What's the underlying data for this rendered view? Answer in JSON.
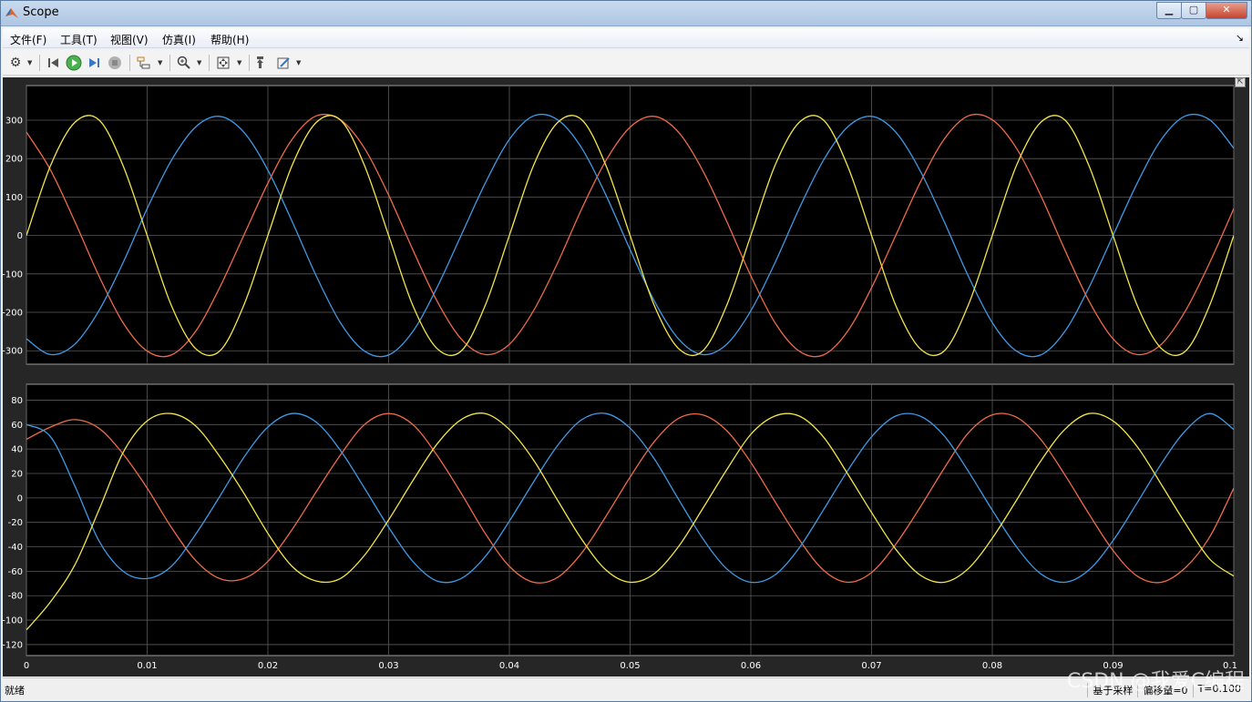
{
  "window": {
    "title": "Scope",
    "min_label": "▁",
    "max_label": "▢",
    "close_label": "✕"
  },
  "menu": {
    "items": [
      "文件(F)",
      "工具(T)",
      "视图(V)",
      "仿真(I)",
      "帮助(H)"
    ],
    "dock_glyph": "↘"
  },
  "toolbar": {
    "icons": [
      "gear-icon",
      "step-back-icon",
      "run-icon",
      "step-forward-icon",
      "stop-icon",
      "signal-select-icon",
      "zoom-icon",
      "autoscale-icon",
      "measure-icon",
      "style-icon"
    ]
  },
  "colors": {
    "series1": "#ee6b4a",
    "series2": "#3f9ae6",
    "series3": "#f4e64a",
    "bg": "#000000",
    "grid": "#5a5a5a",
    "axis_text": "#ffffff"
  },
  "chart_data": [
    {
      "type": "line",
      "xlim": [
        0,
        0.1
      ],
      "ylim": [
        -335,
        390
      ],
      "yticks": [
        -300,
        -200,
        -100,
        0,
        100,
        200,
        300
      ],
      "ytick_labels": [
        "-300",
        "-200",
        "-100",
        "0",
        "100",
        "200",
        "300"
      ],
      "xticks": [
        0,
        0.01,
        0.02,
        0.03,
        0.04,
        0.05,
        0.06,
        0.07,
        0.08,
        0.09,
        0.1
      ],
      "xtick_labels": [],
      "grid": true,
      "series": [
        {
          "color_key": "series1",
          "x": [
            0,
            0.002,
            0.004,
            0.006,
            0.008,
            0.01,
            0.012,
            0.014,
            0.016,
            0.018,
            0.02,
            0.022,
            0.024,
            0.026,
            0.028,
            0.03,
            0.032,
            0.034,
            0.036,
            0.038,
            0.04,
            0.042,
            0.044,
            0.046,
            0.048,
            0.05,
            0.052,
            0.054,
            0.056,
            0.058,
            0.06,
            0.062,
            0.064,
            0.066,
            0.068,
            0.07,
            0.072,
            0.074,
            0.076,
            0.078,
            0.08,
            0.082,
            0.084,
            0.086,
            0.088,
            0.09,
            0.092,
            0.094,
            0.096,
            0.098,
            0.1
          ],
          "y": [
            269,
            170,
            37,
            -105,
            -227,
            -301,
            -311,
            -250,
            -136,
            0,
            136,
            250,
            311,
            301,
            227,
            105,
            -37,
            -170,
            -269,
            -310,
            -283,
            -196,
            -71,
            70,
            195,
            282,
            310,
            269,
            170,
            37,
            -105,
            -227,
            -301,
            -311,
            -250,
            -136,
            0,
            136,
            250,
            311,
            301,
            227,
            105,
            -37,
            -170,
            -269,
            -310,
            -283,
            -196,
            -71,
            70
          ]
        },
        {
          "color_key": "series2",
          "x": [
            0,
            0.002,
            0.004,
            0.006,
            0.008,
            0.01,
            0.012,
            0.014,
            0.016,
            0.018,
            0.02,
            0.022,
            0.024,
            0.026,
            0.028,
            0.03,
            0.032,
            0.034,
            0.036,
            0.038,
            0.04,
            0.042,
            0.044,
            0.046,
            0.048,
            0.05,
            0.052,
            0.054,
            0.056,
            0.058,
            0.06,
            0.062,
            0.064,
            0.066,
            0.068,
            0.07,
            0.072,
            0.074,
            0.076,
            0.078,
            0.08,
            0.082,
            0.084,
            0.086,
            0.088,
            0.09,
            0.092,
            0.094,
            0.096,
            0.098,
            0.1
          ],
          "y": [
            -269,
            -310,
            -283,
            -196,
            -71,
            70,
            195,
            282,
            310,
            269,
            170,
            37,
            -105,
            -227,
            -301,
            -311,
            -250,
            -136,
            0,
            136,
            250,
            311,
            301,
            227,
            105,
            -37,
            -170,
            -269,
            -310,
            -283,
            -196,
            -71,
            70,
            195,
            282,
            310,
            269,
            170,
            37,
            -105,
            -227,
            -301,
            -311,
            -250,
            -136,
            0,
            136,
            250,
            311,
            301,
            227
          ]
        },
        {
          "color_key": "series3",
          "x": [
            0,
            0.002,
            0.004,
            0.006,
            0.008,
            0.01,
            0.012,
            0.014,
            0.016,
            0.018,
            0.02,
            0.022,
            0.024,
            0.026,
            0.028,
            0.03,
            0.032,
            0.034,
            0.036,
            0.038,
            0.04,
            0.042,
            0.044,
            0.046,
            0.048,
            0.05,
            0.052,
            0.054,
            0.056,
            0.058,
            0.06,
            0.062,
            0.064,
            0.066,
            0.068,
            0.07,
            0.072,
            0.074,
            0.076,
            0.078,
            0.08,
            0.082,
            0.084,
            0.086,
            0.088,
            0.09,
            0.092,
            0.094,
            0.096,
            0.098,
            0.1
          ],
          "y": [
            0,
            182,
            294,
            301,
            182,
            0,
            -182,
            -294,
            -301,
            -182,
            0,
            182,
            294,
            301,
            182,
            0,
            -182,
            -294,
            -301,
            -182,
            0,
            182,
            294,
            301,
            182,
            0,
            -182,
            -294,
            -301,
            -182,
            0,
            182,
            294,
            301,
            182,
            0,
            -182,
            -294,
            -301,
            -182,
            0,
            182,
            294,
            301,
            182,
            0,
            -182,
            -294,
            -301,
            -182,
            0
          ]
        }
      ]
    },
    {
      "type": "line",
      "xlim": [
        0,
        0.1
      ],
      "ylim": [
        -129,
        93
      ],
      "yticks": [
        -120,
        -100,
        -80,
        -60,
        -40,
        -20,
        0,
        20,
        40,
        60,
        80
      ],
      "ytick_labels": [
        "-120",
        "-100",
        "-80",
        "-60",
        "-40",
        "-20",
        "0",
        "20",
        "40",
        "60",
        "80"
      ],
      "xticks": [
        0,
        0.01,
        0.02,
        0.03,
        0.04,
        0.05,
        0.06,
        0.07,
        0.08,
        0.09,
        0.1
      ],
      "xtick_labels": [
        "0",
        "0.01",
        "0.02",
        "0.03",
        "0.04",
        "0.05",
        "0.06",
        "0.07",
        "0.08",
        "0.09",
        "0.1"
      ],
      "grid": true,
      "series": [
        {
          "color_key": "series1",
          "x": [
            0,
            0.002,
            0.004,
            0.006,
            0.008,
            0.01,
            0.012,
            0.014,
            0.016,
            0.018,
            0.02,
            0.022,
            0.024,
            0.026,
            0.028,
            0.03,
            0.032,
            0.034,
            0.036,
            0.038,
            0.04,
            0.042,
            0.044,
            0.046,
            0.048,
            0.05,
            0.052,
            0.054,
            0.056,
            0.058,
            0.06,
            0.062,
            0.064,
            0.066,
            0.068,
            0.07,
            0.072,
            0.074,
            0.076,
            0.078,
            0.08,
            0.082,
            0.084,
            0.086,
            0.088,
            0.09,
            0.092,
            0.094,
            0.096,
            0.098,
            0.1
          ],
          "y": [
            48,
            58,
            64,
            57,
            36,
            8,
            -24,
            -51,
            -66,
            -66,
            -52,
            -26,
            5,
            35,
            60,
            69,
            60,
            35,
            4,
            -29,
            -56,
            -69,
            -65,
            -45,
            -15,
            17,
            46,
            65,
            68,
            55,
            29,
            -3,
            -34,
            -59,
            -69,
            -61,
            -38,
            -8,
            24,
            53,
            68,
            66,
            48,
            19,
            -13,
            -43,
            -64,
            -69,
            -57,
            -32,
            8
          ]
        },
        {
          "color_key": "series2",
          "x": [
            0,
            0.002,
            0.004,
            0.006,
            0.008,
            0.01,
            0.012,
            0.014,
            0.016,
            0.018,
            0.02,
            0.022,
            0.024,
            0.026,
            0.028,
            0.03,
            0.032,
            0.034,
            0.036,
            0.038,
            0.04,
            0.042,
            0.044,
            0.046,
            0.048,
            0.05,
            0.052,
            0.054,
            0.056,
            0.058,
            0.06,
            0.062,
            0.064,
            0.066,
            0.068,
            0.07,
            0.072,
            0.074,
            0.076,
            0.078,
            0.08,
            0.082,
            0.084,
            0.086,
            0.088,
            0.09,
            0.092,
            0.094,
            0.096,
            0.098,
            0.1
          ],
          "y": [
            60,
            50,
            10,
            -35,
            -60,
            -66,
            -56,
            -30,
            1,
            33,
            58,
            69,
            62,
            39,
            8,
            -24,
            -52,
            -68,
            -66,
            -48,
            -19,
            13,
            43,
            64,
            69,
            57,
            32,
            -1,
            -33,
            -58,
            -69,
            -63,
            -41,
            -10,
            22,
            50,
            67,
            67,
            51,
            22,
            -10,
            -40,
            -62,
            -69,
            -59,
            -35,
            -4,
            28,
            55,
            69,
            56
          ]
        },
        {
          "color_key": "series3",
          "x": [
            0,
            0.002,
            0.004,
            0.006,
            0.008,
            0.01,
            0.012,
            0.014,
            0.016,
            0.018,
            0.02,
            0.022,
            0.024,
            0.026,
            0.028,
            0.03,
            0.032,
            0.034,
            0.036,
            0.038,
            0.04,
            0.042,
            0.044,
            0.046,
            0.048,
            0.05,
            0.052,
            0.054,
            0.056,
            0.058,
            0.06,
            0.062,
            0.064,
            0.066,
            0.068,
            0.07,
            0.072,
            0.074,
            0.076,
            0.078,
            0.08,
            0.082,
            0.084,
            0.086,
            0.088,
            0.09,
            0.092,
            0.094,
            0.096,
            0.098,
            0.1
          ],
          "y": [
            -108,
            -85,
            -55,
            -10,
            37,
            63,
            69,
            59,
            34,
            4,
            -29,
            -56,
            -68,
            -66,
            -47,
            -18,
            14,
            44,
            64,
            69,
            56,
            31,
            -2,
            -34,
            -59,
            -69,
            -62,
            -40,
            -9,
            23,
            52,
            67,
            67,
            50,
            20,
            -12,
            -42,
            -63,
            -69,
            -58,
            -33,
            -2,
            30,
            56,
            69,
            63,
            42,
            11,
            -21,
            -50,
            -64
          ]
        }
      ]
    }
  ],
  "statusbar": {
    "text": "就绪",
    "right": [
      "基于采样",
      "偏移量=0",
      "T=0.100"
    ]
  },
  "watermark": "CSDN @我爱C编程"
}
